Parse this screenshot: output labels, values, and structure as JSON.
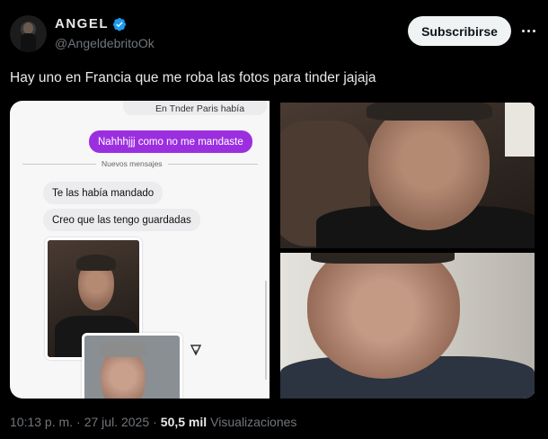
{
  "author": {
    "name": "ANGEL",
    "handle": "@AngeldebritoOk",
    "verified_color": "#1d9bf0"
  },
  "actions": {
    "subscribe_label": "Subscribirse",
    "more_icon": "ellipsis-icon"
  },
  "tweet": {
    "text": "Hay uno en Francia que me roba las fotos para tinder jajaja"
  },
  "chat": {
    "previous_message": "En Tnder Paris había",
    "outgoing_message": "Nahhhjjj como no me mandaste",
    "divider_label": "Nuevos mensajes",
    "incoming_messages": [
      "Te las había mandado",
      "Creo que las tengo guardadas"
    ],
    "accent_color": "#9b2fe0"
  },
  "footer": {
    "time": "10:13 p. m.",
    "separator": "·",
    "date": "27 jul. 2025",
    "separator2": "·",
    "views_count": "50,5 mil",
    "views_label": "Visualizaciones"
  }
}
